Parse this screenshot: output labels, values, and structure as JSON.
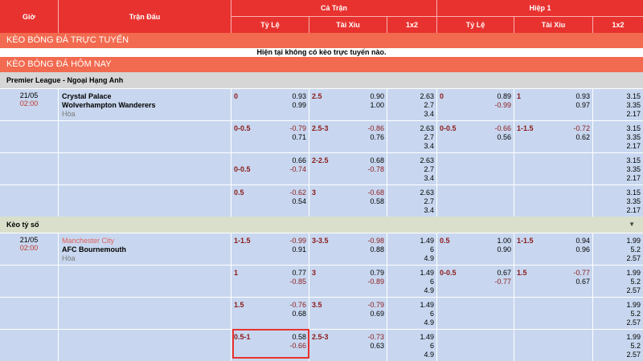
{
  "header": {
    "col_time": "Giờ",
    "col_match": "Trận Đấu",
    "group_full": "Cả Trận",
    "group_half": "Hiệp 1",
    "sub": [
      "Tỷ Lệ",
      "Tài Xỉu",
      "1x2",
      "Tỷ Lệ",
      "Tài Xỉu",
      "1x2"
    ]
  },
  "live": {
    "title": "KÈO BÓNG ĐÁ TRỰC TUYẾN",
    "empty": "Hiện tại không có kèo trực tuyến nào."
  },
  "today": {
    "title": "KÈO BÓNG ĐÁ HÔM NAY",
    "league": "Premier League - Ngoại Hạng Anh",
    "section": "Kèo tỷ số",
    "section_arrow": "▼"
  },
  "match1": {
    "date": "21/05",
    "time": "02:00",
    "home": "Crystal Palace",
    "away": "Wolverhampton Wanderers",
    "draw": "Hòa",
    "rows": [
      {
        "hcap": "0",
        "h1": "0.93",
        "h2": "0.99",
        "ou": "2.5",
        "o1": "0.90",
        "o2": "1.00",
        "x1": "2.63",
        "x2": "2.7",
        "x3": "3.4",
        "hhcap": "0",
        "hh1": "0.89",
        "hh2": "-0.99",
        "hou": "1",
        "ho1": "0.93",
        "ho2": "0.97",
        "hx1": "3.15",
        "hx2": "3.35",
        "hx3": "2.17"
      },
      {
        "hcap": "0-0.5",
        "h1": "-0.79",
        "h2": "0.71",
        "ou": "2.5-3",
        "o1": "-0.86",
        "o2": "0.76",
        "x1": "2.63",
        "x2": "2.7",
        "x3": "3.4",
        "hhcap": "0-0.5",
        "hh1": "-0.66",
        "hh2": "0.56",
        "hou": "1-1.5",
        "ho1": "-0.72",
        "ho2": "0.62",
        "hx1": "3.15",
        "hx2": "3.35",
        "hx3": "2.17"
      },
      {
        "hcap": "0-0.5",
        "h1": "0.66",
        "h2": "-0.74",
        "ou": "2-2.5",
        "o1": "0.68",
        "o2": "-0.78",
        "x1": "2.63",
        "x2": "2.7",
        "x3": "3.4",
        "hhcap": "",
        "hh1": "",
        "hh2": "",
        "hou": "",
        "ho1": "",
        "ho2": "",
        "hx1": "3.15",
        "hx2": "3.35",
        "hx3": "2.17"
      },
      {
        "hcap": "0.5",
        "h1": "-0.62",
        "h2": "0.54",
        "ou": "3",
        "o1": "-0.68",
        "o2": "0.58",
        "x1": "2.63",
        "x2": "2.7",
        "x3": "3.4",
        "hhcap": "",
        "hh1": "",
        "hh2": "",
        "hou": "",
        "ho1": "",
        "ho2": "",
        "hx1": "3.15",
        "hx2": "3.35",
        "hx3": "2.17"
      }
    ]
  },
  "match2": {
    "date": "21/05",
    "time": "02:00",
    "home": "Manchester City",
    "away": "AFC Bournemouth",
    "draw": "Hòa",
    "rows": [
      {
        "hcap": "1-1.5",
        "h1": "-0.99",
        "h2": "0.91",
        "ou": "3-3.5",
        "o1": "-0.98",
        "o2": "0.88",
        "x1": "1.49",
        "x2": "6",
        "x3": "4.9",
        "hhcap": "0.5",
        "hh1": "1.00",
        "hh2": "0.90",
        "hou": "1-1.5",
        "ho1": "0.94",
        "ho2": "0.96",
        "hx1": "1.99",
        "hx2": "5.2",
        "hx3": "2.57"
      },
      {
        "hcap": "1",
        "h1": "0.77",
        "h2": "-0.85",
        "ou": "3",
        "o1": "0.79",
        "o2": "-0.89",
        "x1": "1.49",
        "x2": "6",
        "x3": "4.9",
        "hhcap": "0-0.5",
        "hh1": "0.67",
        "hh2": "-0.77",
        "hou": "1.5",
        "ho1": "-0.77",
        "ho2": "0.67",
        "hx1": "1.99",
        "hx2": "5.2",
        "hx3": "2.57"
      },
      {
        "hcap": "1.5",
        "h1": "-0.76",
        "h2": "0.68",
        "ou": "3.5",
        "o1": "-0.79",
        "o2": "0.69",
        "x1": "1.49",
        "x2": "6",
        "x3": "4.9",
        "hhcap": "",
        "hh1": "",
        "hh2": "",
        "hou": "",
        "ho1": "",
        "ho2": "",
        "hx1": "1.99",
        "hx2": "5.2",
        "hx3": "2.57"
      },
      {
        "hcap": "0.5-1",
        "h1": "0.58",
        "h2": "-0.66",
        "ou": "2.5-3",
        "o1": "-0.73",
        "o2": "0.63",
        "x1": "1.49",
        "x2": "6",
        "x3": "4.9",
        "hhcap": "",
        "hh1": "",
        "hh2": "",
        "hou": "",
        "ho1": "",
        "ho2": "",
        "hx1": "1.99",
        "hx2": "5.2",
        "hx3": "2.57"
      }
    ]
  },
  "colors": {
    "header_bg": "#e8322f",
    "banner_bg": "#f26a4f",
    "row_bg": "#c8d7ef",
    "league_bg": "#d6d6d6",
    "section_bg": "#d9dfcb",
    "accent_red": "#8b1a1a"
  }
}
